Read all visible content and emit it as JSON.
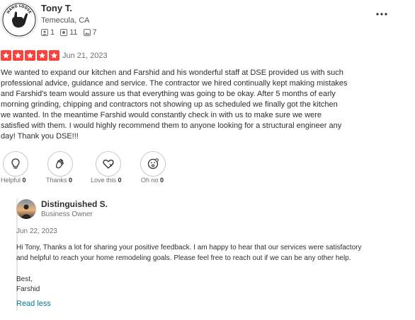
{
  "reviewer": {
    "name": "Tony T.",
    "location": "Temecula, CA",
    "friends": "1",
    "reviews": "11",
    "photos": "7",
    "avatar_text": "HANG LOOSE"
  },
  "review": {
    "rating": 5,
    "date": "Jun 21, 2023",
    "lines": [
      "We wanted to expand our kitchen and Farshid and his wonderful staff at DSE provided us with such",
      "professional advice, guidance and service. The contractor we hired continually kept making mistakes",
      "and Farshid's team would assure us that everything was going to be okay. After 5 months of early",
      "morning grinding, chipping and contractors not showing up as scheduled we finally got the kitchen",
      "we wanted. In the meantime Farshid would constantly check in with us to make sure we were",
      "satisfied with them. I would highly recommend them to anyone looking for a structural engineer any",
      "day! Thank you DSE!!!"
    ]
  },
  "reactions": [
    {
      "label": "Helpful",
      "count": "0",
      "icon": "lightbulb-icon"
    },
    {
      "label": "Thanks",
      "count": "0",
      "icon": "clapping-hands-icon"
    },
    {
      "label": "Love this",
      "count": "0",
      "icon": "heart-icon"
    },
    {
      "label": "Oh no",
      "count": "0",
      "icon": "surprised-face-icon"
    }
  ],
  "owner": {
    "name": "Distinguished S.",
    "role": "Business Owner",
    "date": "Jun 22, 2023",
    "reply_lines": [
      "Hi Tony, Thanks a lot for sharing your positive feedback. I am happy to hear that our services were satisfactory",
      "and helpful to reach your home remodeling goals. Please feel free to reach out if we can be any other help."
    ],
    "closing": "Best,",
    "signature": "Farshid",
    "read_less": "Read less"
  },
  "colors": {
    "star": "#fb433c",
    "link": "#027a97"
  }
}
